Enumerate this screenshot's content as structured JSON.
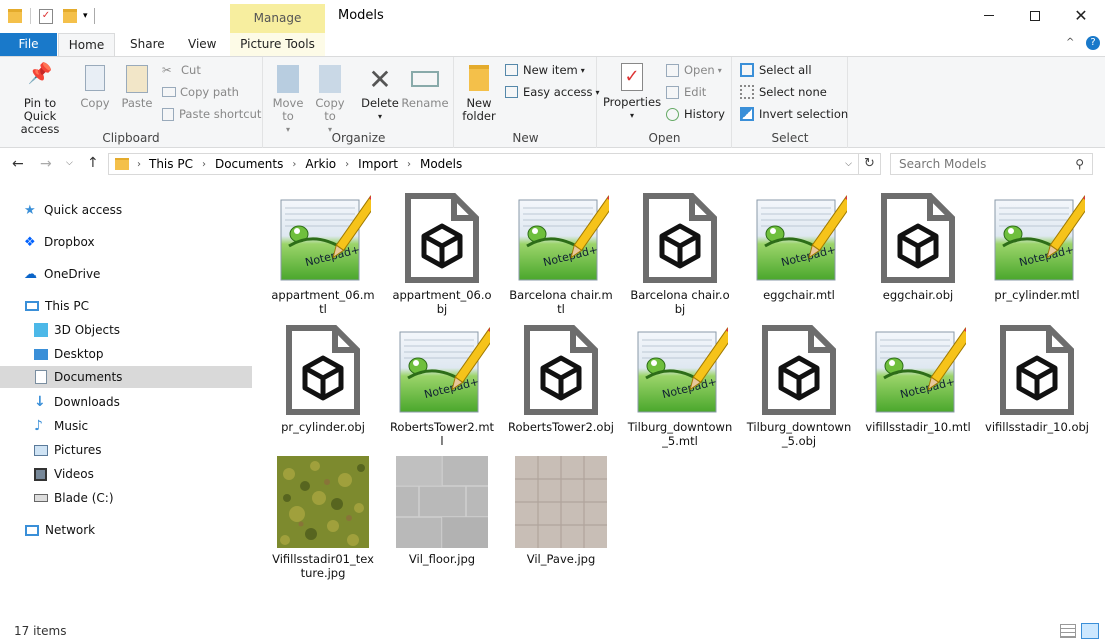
{
  "window": {
    "title": "Models",
    "context_tab": "Manage"
  },
  "tabs": {
    "file": "File",
    "home": "Home",
    "share": "Share",
    "view": "View",
    "picture_tools": "Picture Tools"
  },
  "ribbon": {
    "clipboard": {
      "label": "Clipboard",
      "pin": "Pin to Quick access",
      "copy": "Copy",
      "paste": "Paste",
      "cut": "Cut",
      "copy_path": "Copy path",
      "paste_shortcut": "Paste shortcut"
    },
    "organize": {
      "label": "Organize",
      "move_to": "Move to",
      "copy_to": "Copy to",
      "delete": "Delete",
      "rename": "Rename"
    },
    "new": {
      "label": "New",
      "new_folder": "New folder",
      "new_item": "New item",
      "easy_access": "Easy access"
    },
    "open": {
      "label": "Open",
      "properties": "Properties",
      "open": "Open",
      "edit": "Edit",
      "history": "History"
    },
    "select": {
      "label": "Select",
      "select_all": "Select all",
      "select_none": "Select none",
      "invert": "Invert selection"
    }
  },
  "address": {
    "crumbs": [
      "This PC",
      "Documents",
      "Arkio",
      "Import",
      "Models"
    ],
    "search_placeholder": "Search Models"
  },
  "nav": {
    "quick_access": "Quick access",
    "dropbox": "Dropbox",
    "onedrive": "OneDrive",
    "this_pc": "This PC",
    "objects3d": "3D Objects",
    "desktop": "Desktop",
    "documents": "Documents",
    "downloads": "Downloads",
    "music": "Music",
    "pictures": "Pictures",
    "videos": "Videos",
    "blade": "Blade (C:)",
    "network": "Network"
  },
  "files": [
    {
      "name": "appartment_06.mtl",
      "kind": "notepad"
    },
    {
      "name": "appartment_06.obj",
      "kind": "obj"
    },
    {
      "name": "Barcelona chair.mtl",
      "kind": "notepad"
    },
    {
      "name": "Barcelona chair.obj",
      "kind": "obj"
    },
    {
      "name": "eggchair.mtl",
      "kind": "notepad"
    },
    {
      "name": "eggchair.obj",
      "kind": "obj"
    },
    {
      "name": "pr_cylinder.mtl",
      "kind": "notepad"
    },
    {
      "name": "pr_cylinder.obj",
      "kind": "obj"
    },
    {
      "name": "RobertsTower2.mtl",
      "kind": "notepad"
    },
    {
      "name": "RobertsTower2.obj",
      "kind": "obj"
    },
    {
      "name": "Tilburg_downtown_5.mtl",
      "kind": "notepad"
    },
    {
      "name": "Tilburg_downtown_5.obj",
      "kind": "obj"
    },
    {
      "name": "vifillsstadir_10.mtl",
      "kind": "notepad"
    },
    {
      "name": "vifillsstadir_10.obj",
      "kind": "obj"
    },
    {
      "name": "Vifillsstadir01_texture.jpg",
      "kind": "grass"
    },
    {
      "name": "Vil_floor.jpg",
      "kind": "floor"
    },
    {
      "name": "Vil_Pave.jpg",
      "kind": "pave"
    }
  ],
  "status": {
    "count": "17 items"
  },
  "colors": {
    "accent": "#1979ca",
    "manage": "#f7ee9f",
    "selected": "#d9d9d9"
  }
}
